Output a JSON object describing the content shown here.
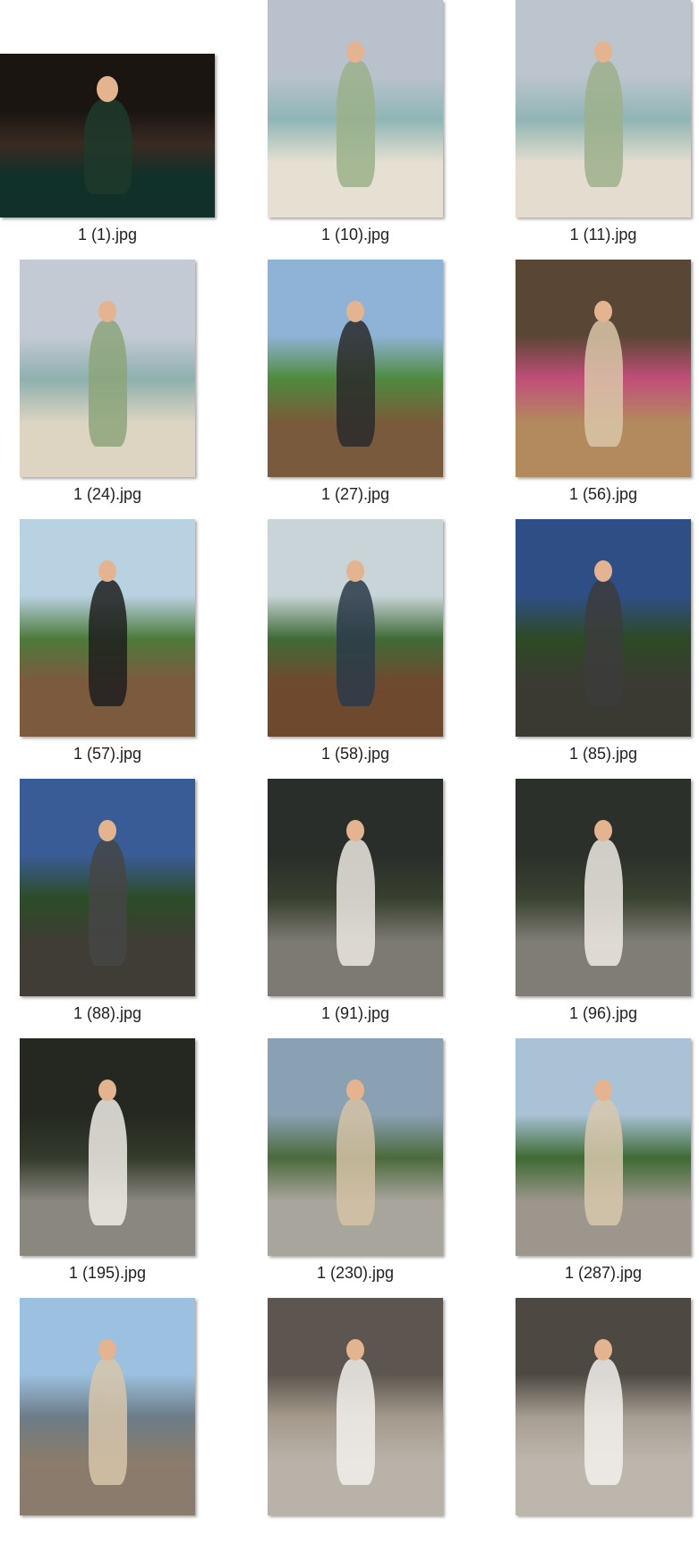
{
  "window": {
    "background": "#ffffff"
  },
  "files": [
    {
      "name": "1 (1).jpg",
      "orientation": "landscape",
      "sky": "#1b1512",
      "mid": "#3a2a22",
      "ground": "#10302a",
      "figure": "#1d3a2c"
    },
    {
      "name": "1 (10).jpg",
      "orientation": "portrait",
      "sky": "#b9c2cc",
      "mid": "#8fb6b6",
      "ground": "#e6e0d2",
      "figure": "#9bb08a"
    },
    {
      "name": "1 (11).jpg",
      "orientation": "portrait",
      "sky": "#bcc4cd",
      "mid": "#90b5b4",
      "ground": "#e4ddcf",
      "figure": "#9db08b"
    },
    {
      "name": "1 (24).jpg",
      "orientation": "portrait",
      "sky": "#c4cad3",
      "mid": "#8eb0ae",
      "ground": "#ddd4c2",
      "figure": "#8da57a"
    },
    {
      "name": "1 (27).jpg",
      "orientation": "portrait",
      "sky": "#8fb3d6",
      "mid": "#4f8a3e",
      "ground": "#7a5a3c",
      "figure": "#2a2a2a"
    },
    {
      "name": "1 (56).jpg",
      "orientation": "portrait",
      "sky": "#5a4634",
      "mid": "#c14f7a",
      "ground": "#b28a5e",
      "figure": "#d9c6a8"
    },
    {
      "name": "1 (57).jpg",
      "orientation": "portrait",
      "sky": "#b9d2e2",
      "mid": "#4d7a3a",
      "ground": "#7c5a3e",
      "figure": "#1f1f1f"
    },
    {
      "name": "1 (58).jpg",
      "orientation": "portrait",
      "sky": "#c9d4d8",
      "mid": "#3f6b36",
      "ground": "#6e4a2e",
      "figure": "#2c3a4a"
    },
    {
      "name": "1 (85).jpg",
      "orientation": "portrait",
      "sky": "#2f4e86",
      "mid": "#2d4a24",
      "ground": "#3b3a33",
      "figure": "#3c3c3c"
    },
    {
      "name": "1 (88).jpg",
      "orientation": "portrait",
      "sky": "#3a5c96",
      "mid": "#2c4c26",
      "ground": "#3f3d35",
      "figure": "#454545"
    },
    {
      "name": "1 (91).jpg",
      "orientation": "portrait",
      "sky": "#2a2e2a",
      "mid": "#37402e",
      "ground": "#7d7a74",
      "figure": "#ece8e2"
    },
    {
      "name": "1 (96).jpg",
      "orientation": "portrait",
      "sky": "#2c302b",
      "mid": "#3a4230",
      "ground": "#807d77",
      "figure": "#eeeae4"
    },
    {
      "name": "1 (195).jpg",
      "orientation": "portrait",
      "sky": "#252821",
      "mid": "#343b2b",
      "ground": "#8a8780",
      "figure": "#f0ece6"
    },
    {
      "name": "1 (230).jpg",
      "orientation": "portrait",
      "sky": "#8aa1b4",
      "mid": "#4b6a3c",
      "ground": "#a9a59d",
      "figure": "#d3c2a6"
    },
    {
      "name": "1 (287).jpg",
      "orientation": "portrait",
      "sky": "#a9c2d6",
      "mid": "#3e6a34",
      "ground": "#9c968c",
      "figure": "#d8c8ad"
    },
    {
      "name": "",
      "orientation": "portrait",
      "sky": "#9cc0e0",
      "mid": "#6c7c86",
      "ground": "#8b7c6c",
      "figure": "#d7c6aa"
    },
    {
      "name": "",
      "orientation": "portrait",
      "sky": "#5d5650",
      "mid": "#a49a8c",
      "ground": "#b8b2a8",
      "figure": "#f2f0ec"
    },
    {
      "name": "",
      "orientation": "portrait",
      "sky": "#4d4842",
      "mid": "#a79e92",
      "ground": "#bcb6ac",
      "figure": "#f3f1ed"
    }
  ]
}
